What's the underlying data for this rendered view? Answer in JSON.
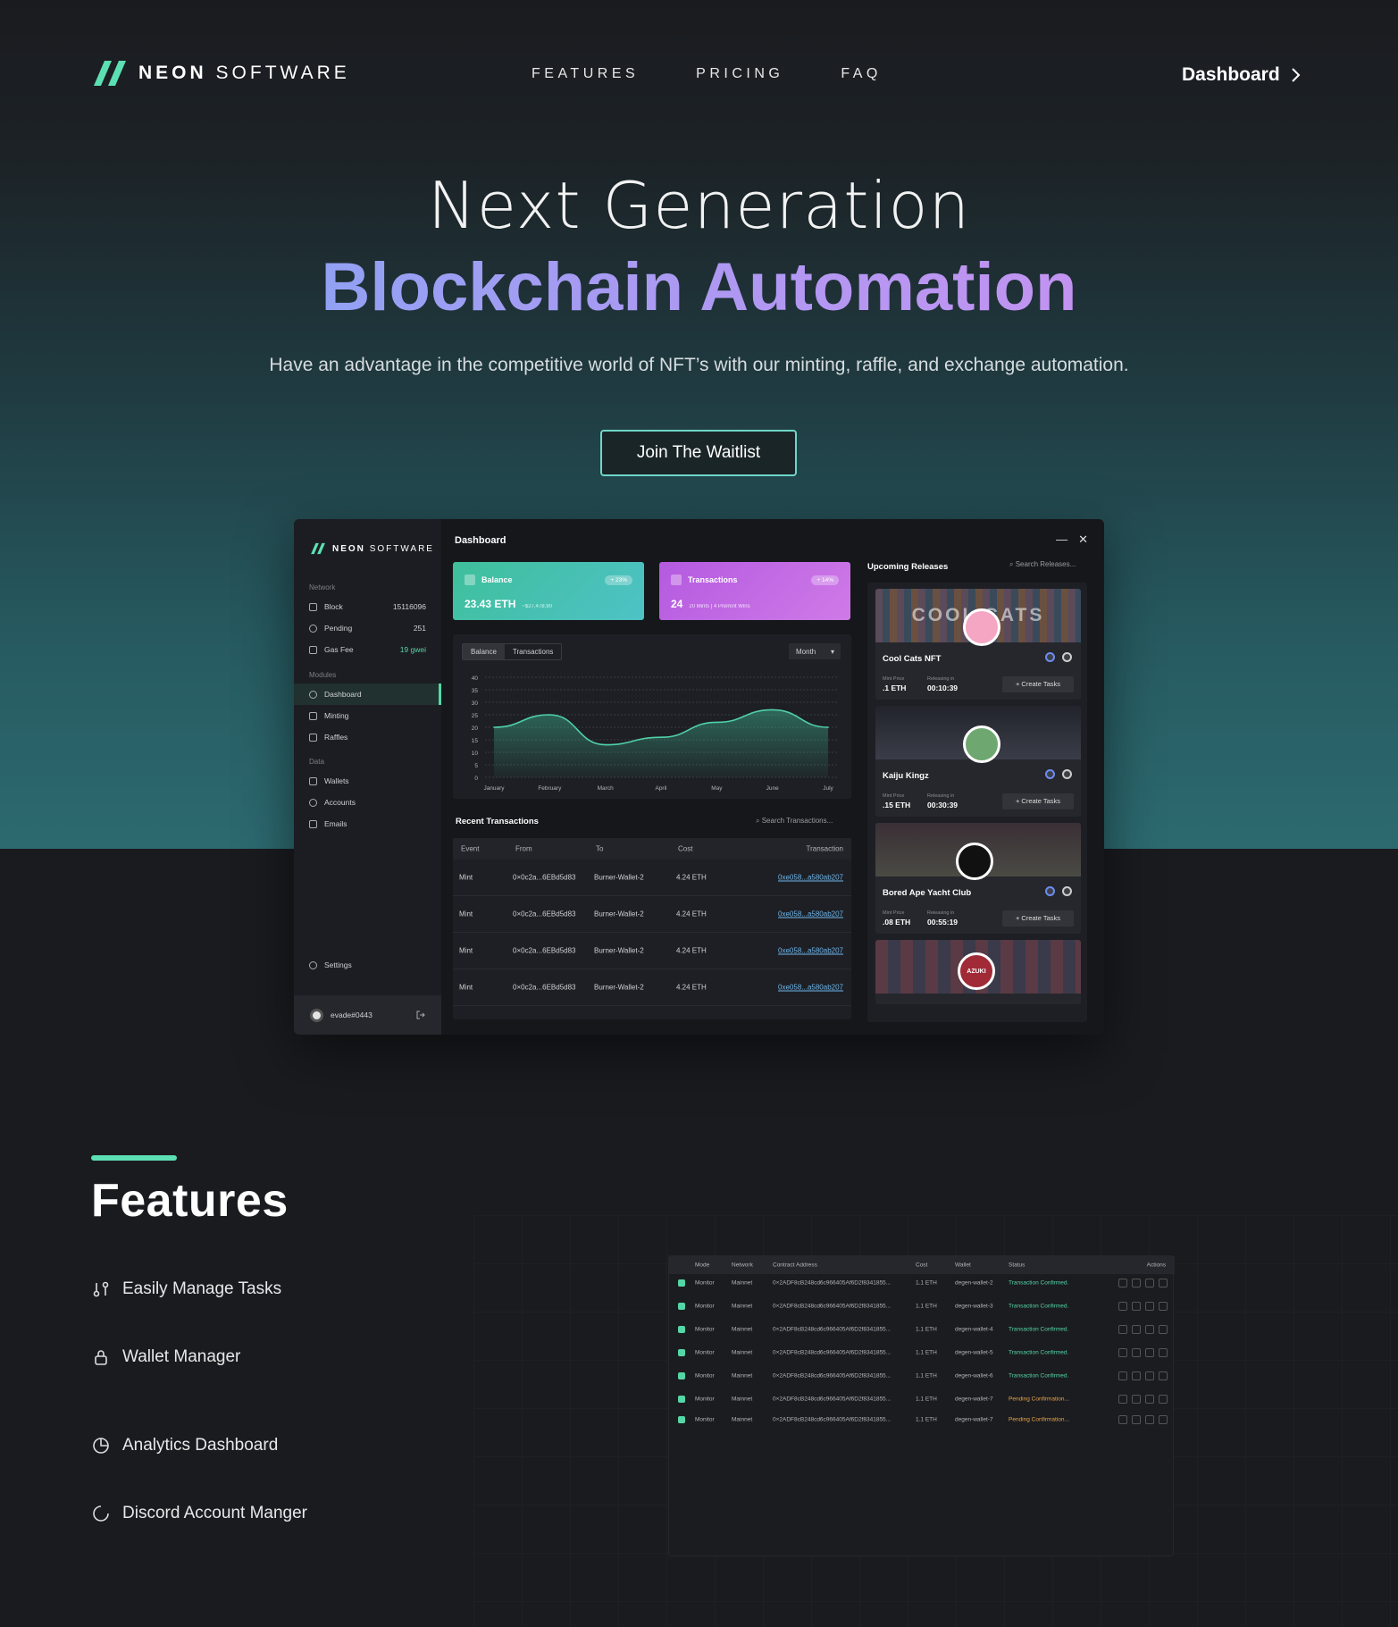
{
  "brand": {
    "bold": "NEON",
    "light": "SOFTWARE",
    "accent": "#5ce0b3"
  },
  "nav": {
    "links": [
      "FEATURES",
      "PRICING",
      "FAQ"
    ],
    "dashboard": "Dashboard"
  },
  "hero": {
    "line1": "Next Generation",
    "line2": "Blockchain Automation",
    "subtitle": "Have an advantage in the competitive world of NFT’s with our minting, raffle, and exchange automation.",
    "cta": "Join The Waitlist"
  },
  "app": {
    "brand_bold": "NEON",
    "brand_light": "SOFTWARE",
    "title": "Dashboard",
    "sections": {
      "network": "Network",
      "modules": "Modules",
      "data": "Data"
    },
    "network": [
      {
        "label": "Block",
        "value": "15116096"
      },
      {
        "label": "Pending",
        "value": "251"
      },
      {
        "label": "Gas Fee",
        "value": "19 gwei"
      }
    ],
    "modules": [
      "Dashboard",
      "Minting",
      "Raffles"
    ],
    "data_items": [
      "Wallets",
      "Accounts",
      "Emails"
    ],
    "settings": "Settings",
    "user": "evade#0443",
    "balance": {
      "label": "Balance",
      "badge": "+ 23%",
      "value": "23.43 ETH",
      "sub": "~$27,478.90"
    },
    "transactions": {
      "label": "Transactions",
      "badge": "+ 14%",
      "value": "24",
      "sub": "20 Mints | 4 Premint Wins"
    },
    "chart_tabs": [
      "Balance",
      "Transactions"
    ],
    "chart_period": "Month",
    "recent_title": "Recent Transactions",
    "recent_search": "Search Transactions...",
    "recent_headers": [
      "Event",
      "From",
      "To",
      "Cost",
      "Transaction"
    ],
    "recent_rows": [
      [
        "Mint",
        "0×0c2a...6EBd5d83",
        "Burner-Wallet-2",
        "4.24 ETH",
        "0xe058...a580ab207"
      ],
      [
        "Mint",
        "0×0c2a...6EBd5d83",
        "Burner-Wallet-2",
        "4.24 ETH",
        "0xe058...a580ab207"
      ],
      [
        "Mint",
        "0×0c2a...6EBd5d83",
        "Burner-Wallet-2",
        "4.24 ETH",
        "0xe058...a580ab207"
      ],
      [
        "Mint",
        "0×0c2a...6EBd5d83",
        "Burner-Wallet-2",
        "4.24 ETH",
        "0xe058...a580ab207"
      ]
    ],
    "upcoming_title": "Upcoming Releases",
    "upcoming_search": "Search Releases...",
    "releases": [
      {
        "name": "Cool Cats NFT",
        "price_label": "Mint Price",
        "price": ".1 ETH",
        "time_label": "Releasing in",
        "time": "00:10:39",
        "button": "+ Create Tasks",
        "banner": "COOL CATS"
      },
      {
        "name": "Kaiju Kingz",
        "price_label": "Mint Price",
        "price": ".15 ETH",
        "time_label": "Releasing in",
        "time": "00:30:39",
        "button": "+ Create Tasks",
        "banner": ""
      },
      {
        "name": "Bored Ape Yacht Club",
        "price_label": "Mint Price",
        "price": ".08 ETH",
        "time_label": "Releasing in",
        "time": "00:55:19",
        "button": "+ Create Tasks",
        "banner": ""
      },
      {
        "name": "",
        "price_label": "",
        "price": "",
        "time_label": "",
        "time": "",
        "button": "",
        "banner": "AZUKI"
      }
    ]
  },
  "chart_data": {
    "type": "area",
    "categories": [
      "January",
      "February",
      "March",
      "April",
      "May",
      "June",
      "July"
    ],
    "series": [
      {
        "values": [
          20,
          25,
          13,
          16,
          22,
          27,
          20
        ]
      }
    ],
    "yticks": [
      0,
      5,
      10,
      15,
      20,
      25,
      30,
      35,
      40
    ],
    "ylim": [
      0,
      40
    ],
    "grid": true
  },
  "features": {
    "title": "Features",
    "items": [
      "Easily Manage Tasks",
      "Wallet Manager",
      "Analytics Dashboard",
      "Discord Account Manger"
    ]
  },
  "task_table": {
    "headers": [
      "Mode",
      "Network",
      "Contract Address",
      "Cost",
      "Wallet",
      "Status",
      "Actions"
    ],
    "rows": [
      [
        "Monitor",
        "Mainnet",
        "0×2ADF8cB248cd6c966405Af6D2f8341855...",
        "1.1 ETH",
        "degen-wallet-2",
        "Transaction Confirmed."
      ],
      [
        "Monitor",
        "Mainnet",
        "0×2ADF8cB248cd6c966405Af6D2f8341855...",
        "1.1 ETH",
        "degen-wallet-3",
        "Transaction Confirmed."
      ],
      [
        "Monitor",
        "Mainnet",
        "0×2ADF8cB248cd6c966405Af6D2f8341855...",
        "1.1 ETH",
        "degen-wallet-4",
        "Transaction Confirmed."
      ],
      [
        "Monitor",
        "Mainnet",
        "0×2ADF8cB248cd6c966405Af6D2f8341855...",
        "1.1 ETH",
        "degen-wallet-5",
        "Transaction Confirmed."
      ],
      [
        "Monitor",
        "Mainnet",
        "0×2ADF8cB248cd6c966405Af6D2f8341855...",
        "1.1 ETH",
        "degen-wallet-6",
        "Transaction Confirmed."
      ],
      [
        "Monitor",
        "Mainnet",
        "0×2ADF8cB248cd6c966405Af6D2f8341855...",
        "1.1 ETH",
        "degen-wallet-7",
        "Pending Confirmation..."
      ],
      [
        "Monitor",
        "Mainnet",
        "0×2ADF8cB248cd6c966405Af6D2f8341855...",
        "1.1 ETH",
        "degen-wallet-7",
        "Pending Confirmation..."
      ]
    ]
  }
}
